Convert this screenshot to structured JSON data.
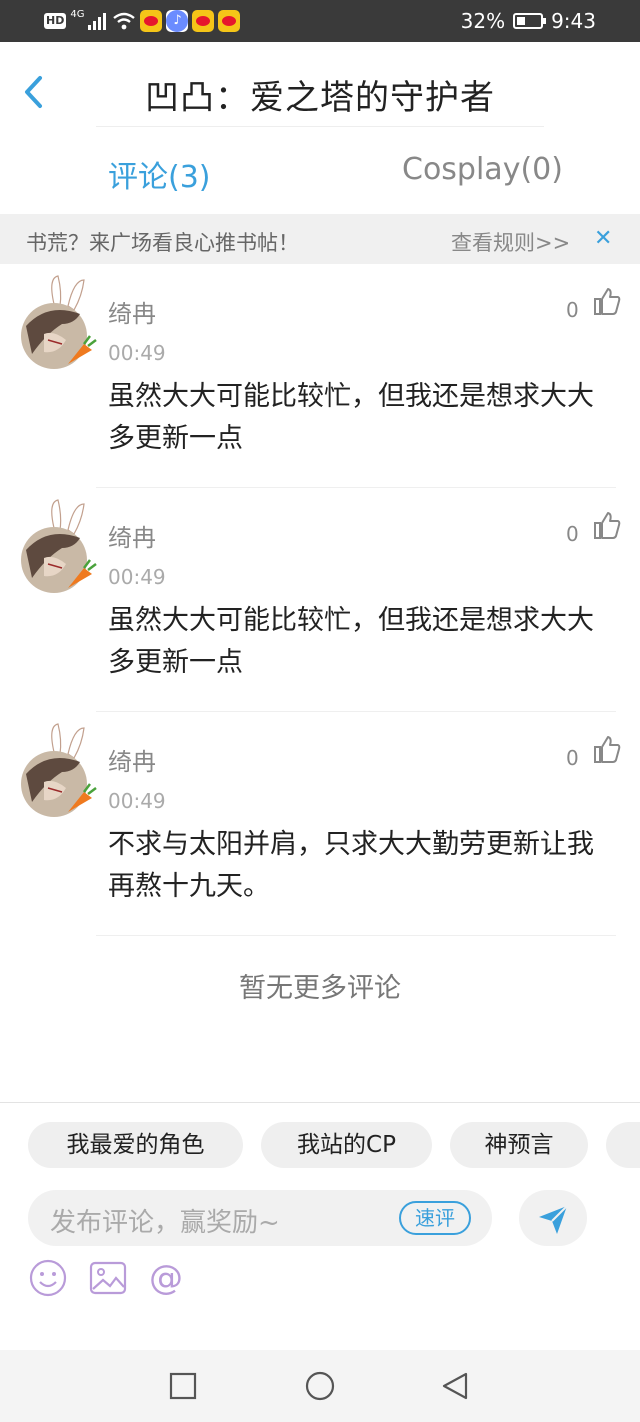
{
  "status_bar": {
    "network_label": "HD",
    "network_type": "4G",
    "battery_percent": "32%",
    "time": "9:43"
  },
  "header": {
    "title": "凹凸：爱之塔的守护者",
    "back_icon": "chevron-left-icon"
  },
  "tabs": [
    {
      "label": "评论(3)",
      "active": true
    },
    {
      "label": "Cosplay(0)",
      "active": false
    }
  ],
  "notice": {
    "text": "书荒？来广场看良心推书帖！",
    "link": "查看规则>>",
    "close_icon": "close-icon"
  },
  "comments": [
    {
      "user": "绮冉",
      "time": "00:49",
      "likes": "0",
      "body": "虽然大大可能比较忙，但我还是想求大大多更新一点"
    },
    {
      "user": "绮冉",
      "time": "00:49",
      "likes": "0",
      "body": "虽然大大可能比较忙，但我还是想求大大多更新一点"
    },
    {
      "user": "绮冉",
      "time": "00:49",
      "likes": "0",
      "body": "不求与太阳并肩，只求大大勤劳更新让我再熬十九天。"
    }
  ],
  "no_more_text": "暂无更多评论",
  "composer": {
    "chips": [
      "我最爱的角色",
      "我站的CP",
      "神预言"
    ],
    "placeholder": "发布评论，赢奖励~",
    "quick_label": "速评",
    "send_icon": "send-icon",
    "tools": [
      "emoji-icon",
      "image-icon",
      "mention-icon"
    ]
  },
  "nav": [
    "recent-apps-icon",
    "home-icon",
    "back-icon"
  ],
  "colors": {
    "accent": "#3aa0dc",
    "status_bar_bg": "#3a3a3a",
    "icon_purple": "#b99bd9"
  }
}
